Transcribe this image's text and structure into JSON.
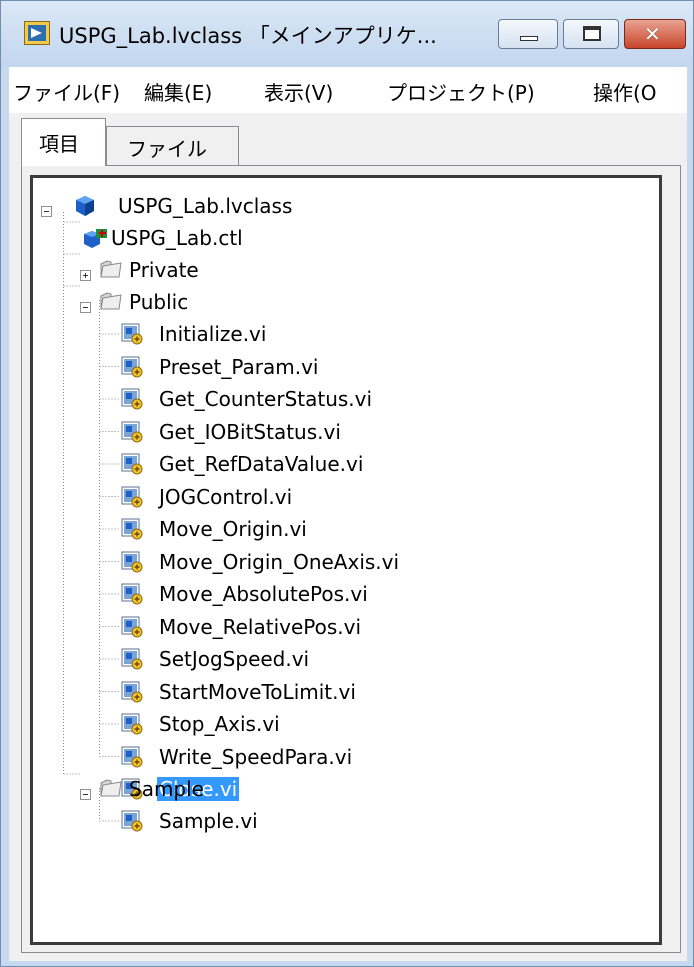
{
  "window": {
    "title": "USPG_Lab.lvclass 「メインアプリケ...",
    "icon": "labview-project-icon"
  },
  "window_controls": {
    "minimize": "minimize-icon",
    "maximize": "maximize-icon",
    "close": "close-icon"
  },
  "menu": [
    "ファイル(F)",
    "編集(E)",
    "表示(V)",
    "プロジェクト(P)",
    "操作(O"
  ],
  "tabs": [
    {
      "label": "項目",
      "active": true
    },
    {
      "label": "ファイル",
      "active": false
    }
  ],
  "tree": {
    "root": "USPG_Lab.lvclass",
    "control": "USPG_Lab.ctl",
    "folders": [
      "Private",
      "Public",
      "Sample"
    ],
    "public_items": [
      "Initialize.vi",
      "Preset_Param.vi",
      "Get_CounterStatus.vi",
      "Get_IOBitStatus.vi",
      "Get_RefDataValue.vi",
      "JOGControl.vi",
      "Move_Origin.vi",
      "Move_Origin_OneAxis.vi",
      "Move_AbsolutePos.vi",
      "Move_RelativePos.vi",
      "SetJogSpeed.vi",
      "StartMoveToLimit.vi",
      "Stop_Axis.vi",
      "Write_SpeedPara.vi",
      "Close.vi"
    ],
    "sample_items": [
      "Sample.vi"
    ],
    "selected": "Close.vi"
  }
}
